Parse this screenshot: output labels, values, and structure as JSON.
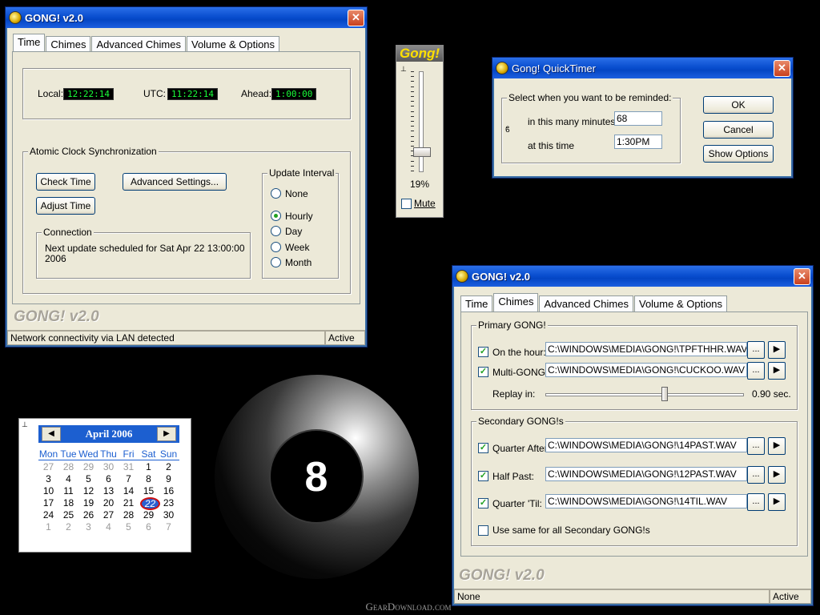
{
  "main_window": {
    "title": "GONG! v2.0",
    "tabs": [
      "Time",
      "Chimes",
      "Advanced Chimes",
      "Volume & Options"
    ],
    "clock": {
      "local_label": "Local:",
      "local_value": "12:22:14",
      "utc_label": "UTC:",
      "utc_value": "11:22:14",
      "ahead_label": "Ahead:",
      "ahead_value": "1:00:00"
    },
    "atomic": {
      "legend": "Atomic Clock Synchronization",
      "check_time": "Check Time",
      "advanced_settings": "Advanced Settings...",
      "adjust_time": "Adjust Time",
      "update_interval_legend": "Update Interval",
      "intervals": [
        "None",
        "Hourly",
        "Day",
        "Week",
        "Month"
      ],
      "selected_interval": "Hourly",
      "connection_legend": "Connection",
      "connection_text_1": "Next update scheduled for Sat Apr 22 13:00:00",
      "connection_text_2": "2006"
    },
    "brand": "GONG! v2.0",
    "status_left": "Network connectivity via LAN detected",
    "status_right": "Active"
  },
  "volume_widget": {
    "title": "Gong!",
    "percent": "19%",
    "level": 0.19,
    "mute_label": "Mute"
  },
  "quicktimer": {
    "title": "Gong! QuickTimer",
    "legend": "Select when you want to be reminded:",
    "minutes_label": "in this many minutes",
    "minutes_value": "68",
    "time_label": "at this time",
    "time_value": "1:30PM",
    "ok": "OK",
    "cancel": "Cancel",
    "show_options": "Show Options"
  },
  "calendar": {
    "month": "April 2006",
    "weekdays": [
      "Mon",
      "Tue",
      "Wed",
      "Thu",
      "Fri",
      "Sat",
      "Sun"
    ],
    "weeks": [
      [
        "27",
        "28",
        "29",
        "30",
        "31",
        "1",
        "2"
      ],
      [
        "3",
        "4",
        "5",
        "6",
        "7",
        "8",
        "9"
      ],
      [
        "10",
        "11",
        "12",
        "13",
        "14",
        "15",
        "16"
      ],
      [
        "17",
        "18",
        "19",
        "20",
        "21",
        "22",
        "23"
      ],
      [
        "24",
        "25",
        "26",
        "27",
        "28",
        "29",
        "30"
      ],
      [
        "1",
        "2",
        "3",
        "4",
        "5",
        "6",
        "7"
      ]
    ],
    "today": "22"
  },
  "eightball": {
    "number": "8"
  },
  "chimes_window": {
    "title": "GONG! v2.0",
    "tabs": [
      "Time",
      "Chimes",
      "Advanced Chimes",
      "Volume & Options"
    ],
    "primary_legend": "Primary GONG!",
    "on_the_hour_label": "On the hour:",
    "on_the_hour_file": "C:\\WINDOWS\\MEDIA\\GONG!\\TPFTHHR.WAV",
    "multi_label": "Multi-GONG!:",
    "multi_file": "C:\\WINDOWS\\MEDIA\\GONG!\\CUCKOO.WAV",
    "replay_label": "Replay in:",
    "replay_value": "0.90 sec.",
    "replay_level": 0.6,
    "secondary_legend": "Secondary GONG!s",
    "quarter_after_label": "Quarter After:",
    "quarter_after_file": "C:\\WINDOWS\\MEDIA\\GONG!\\14PAST.WAV",
    "half_past_label": "Half Past:",
    "half_past_file": "C:\\WINDOWS\\MEDIA\\GONG!\\12PAST.WAV",
    "quarter_til_label": "Quarter 'Til:",
    "quarter_til_file": "C:\\WINDOWS\\MEDIA\\GONG!\\14TIL.WAV",
    "same_for_all_label": "Use same for all Secondary GONG!s",
    "browse_label": "...",
    "play_label": "▶",
    "brand": "GONG! v2.0",
    "status_left": "None",
    "status_right": "Active"
  },
  "watermark": "GearDownload.com"
}
